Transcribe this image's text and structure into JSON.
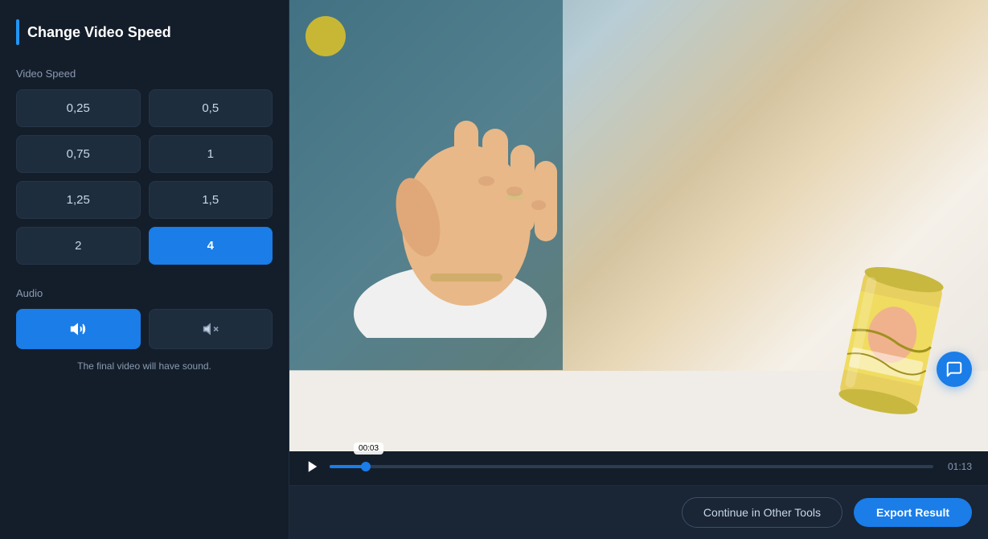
{
  "app": {
    "title": "Change Video Speed"
  },
  "left_panel": {
    "title": "Change Video Speed",
    "video_speed_label": "Video Speed",
    "speed_options": [
      {
        "value": "0,25",
        "id": "s025",
        "active": false
      },
      {
        "value": "0,5",
        "id": "s05",
        "active": false
      },
      {
        "value": "0,75",
        "id": "s075",
        "active": false
      },
      {
        "value": "1",
        "id": "s1",
        "active": false
      },
      {
        "value": "1,25",
        "id": "s125",
        "active": false
      },
      {
        "value": "1,5",
        "id": "s15",
        "active": false
      },
      {
        "value": "2",
        "id": "s2",
        "active": false
      },
      {
        "value": "4",
        "id": "s4",
        "active": true
      }
    ],
    "audio_label": "Audio",
    "audio_sound_note": "The final video will have sound.",
    "audio_buttons": {
      "sound_on": "🔊",
      "sound_off": "🔇"
    }
  },
  "video_player": {
    "current_time": "00:03",
    "end_time": "01:13",
    "progress_percent": 6
  },
  "bottom_bar": {
    "continue_label": "Continue in Other Tools",
    "export_label": "Export Result"
  }
}
